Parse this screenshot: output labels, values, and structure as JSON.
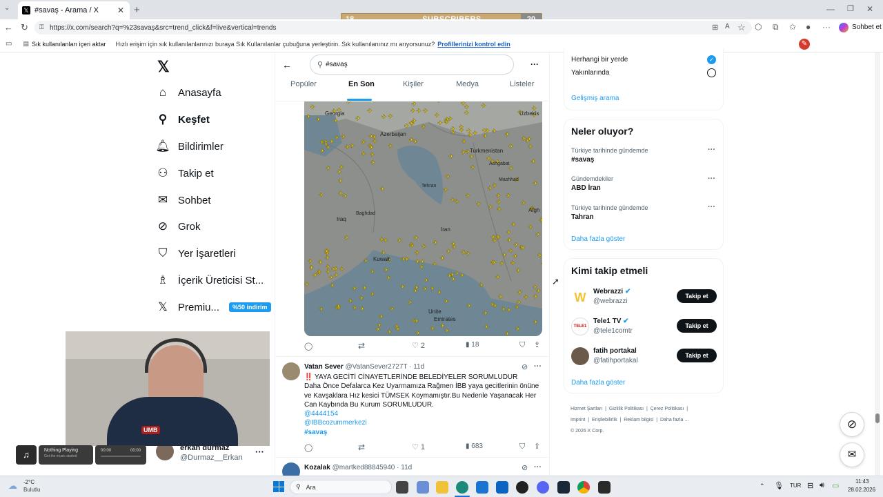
{
  "browser": {
    "tab_title": "#savaş - Arama / X",
    "url": "https://x.com/search?q=%23savaş&src=trend_click&f=live&vertical=trends",
    "fav_import": "Sık kullanılanları içeri aktar",
    "fav_hint": "Hızlı erişim için sık kullanılanlarınızı buraya Sık Kullanılanlar çubuğuna yerleştirin. Sık kullanılanınız mı arıyorsunuz?",
    "fav_link": "Profillerinizi kontrol edin",
    "sohbet_label": "Sohbet et"
  },
  "overlay": {
    "subs_left": "18",
    "subs_label": "SUBSCRIBERS",
    "subs_right": "20"
  },
  "sidebar": {
    "items": [
      {
        "label": "Anasayfa"
      },
      {
        "label": "Keşfet"
      },
      {
        "label": "Bildirimler"
      },
      {
        "label": "Takip et"
      },
      {
        "label": "Sohbet"
      },
      {
        "label": "Grok"
      },
      {
        "label": "Yer İşaretleri"
      },
      {
        "label": "İçerik Üreticisi St..."
      },
      {
        "label": "Premiu..."
      }
    ],
    "premium_badge": "%50 indirim",
    "account_name": "erkan durmaz",
    "account_handle": "@Durmaz__Erkan"
  },
  "search": {
    "query": "#savaş",
    "tabs": [
      "Popüler",
      "En Son",
      "Kişiler",
      "Medya",
      "Listeler"
    ],
    "active_tab": 1
  },
  "map": {
    "labels": [
      "Uzbekis",
      "Georgia",
      "Azerbaijan",
      "Turkmenistan",
      "Ashgabat",
      "Tehran",
      "Mashhad",
      "Afgh",
      "Baghdad",
      "Iraq",
      "Iran",
      "Kuwait",
      "Unite",
      "Emirates"
    ]
  },
  "posts": [
    {
      "stats": {
        "replies": "",
        "reposts": "",
        "likes": "2",
        "views": "18"
      }
    },
    {
      "name": "Vatan Sever",
      "handle": "@VatanSever2727T",
      "time": "· 11d",
      "line1": "‼️ YAYA GECİTİ CİNAYETLERİNDE BELEDİYELER SORUMLUDUR",
      "line2": "Daha Önce Defalarca Kez Uyarmamıza Rağmen İBB yaya gecitlerinin önüne ve Kavşaklara  Hız kesici TÜMSEK Koymamıştır.Bu Nedenle Yaşanacak Her Can Kaybında Bu Kurum SORUMLUDUR.",
      "mention1": "@4444154",
      "mention2": "@IBBcozummerkezi",
      "hashtag": "#savaş",
      "stats": {
        "likes": "1",
        "views": "683"
      }
    },
    {
      "name": "Kozalak",
      "handle": "@martked88845940",
      "time": "· 11d"
    }
  ],
  "right": {
    "location_any": "Herhangi bir yerde",
    "location_near": "Yakınlarında",
    "advanced": "Gelişmiş arama",
    "trends_title": "Neler oluyor?",
    "trends": [
      {
        "context": "Türkiye tarihinde gündemde",
        "name": "#savaş"
      },
      {
        "context": "Gündemdekiler",
        "name": "ABD İran"
      },
      {
        "context": "Türkiye tarihinde gündemde",
        "name": "Tahran"
      }
    ],
    "show_more": "Daha fazla göster",
    "who_title": "Kimi takip etmeli",
    "who": [
      {
        "name": "Webrazzi",
        "handle": "@webrazzi",
        "button": "Takip et"
      },
      {
        "name": "Tele1 TV",
        "handle": "@tele1comtr",
        "button": "Takip et"
      },
      {
        "name": "fatih portakal",
        "handle": "@fatihportakal",
        "button": "Takip et"
      }
    ],
    "who_more": "Daha fazla göster",
    "footer_links": [
      "Hizmet Şartları",
      "Gizlilik Politikası",
      "Çerez Politikası",
      "Imprint",
      "Erişilebilirlik",
      "Reklam bilgisi",
      "Daha fazla ..."
    ],
    "copyright": "© 2026 X Corp."
  },
  "music": {
    "title": "Nothing Playing",
    "subtitle": "Get the music started",
    "time_start": "00:00",
    "time_end": "00:00"
  },
  "taskbar": {
    "weather_temp": "-2°C",
    "weather_desc": "Bulutlu",
    "search_placeholder": "Ara",
    "lang": "TUR",
    "time": "11:43",
    "date": "28.02.2026"
  },
  "colors": {
    "accent": "#1d9bf0",
    "dark": "#0f1419",
    "muted": "#536471"
  }
}
